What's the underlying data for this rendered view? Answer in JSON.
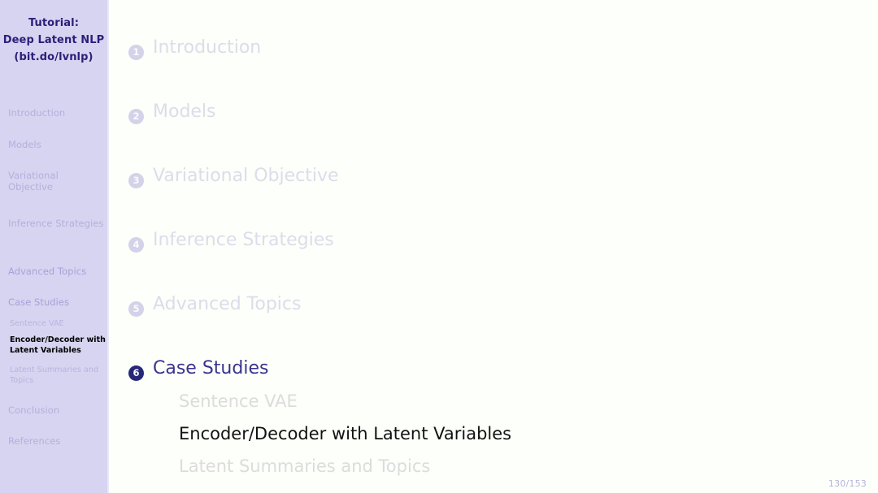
{
  "slide": {
    "kind": "beamer-outline-slide",
    "background_color": "#fdfffa",
    "page_number": "130/153"
  },
  "sidebar": {
    "background_color": "#d6d4f0",
    "title_lines": [
      "Tutorial:",
      "Deep Latent NLP",
      "(bit.do/lvnlp)"
    ],
    "title_color": "#2a1f7a",
    "sections": [
      {
        "label": "Introduction",
        "state": "inactive"
      },
      {
        "label": "Models",
        "state": "inactive"
      },
      {
        "label": "Variational Objective",
        "state": "inactive"
      },
      {
        "label": "Inference Strategies",
        "state": "inactive"
      },
      {
        "label": "Advanced Topics",
        "state": "visited"
      },
      {
        "label": "Case Studies",
        "state": "current"
      },
      {
        "label": "Conclusion",
        "state": "inactive"
      },
      {
        "label": "References",
        "state": "inactive"
      }
    ],
    "subsections": [
      {
        "label": "Sentence VAE",
        "state": "inactive"
      },
      {
        "label": "Encoder/Decoder with Latent Variables",
        "state": "active"
      },
      {
        "label": "Latent Summaries and Topics",
        "state": "inactive"
      }
    ]
  },
  "outline": {
    "sections": [
      {
        "number": "1",
        "label": "Introduction",
        "state": "inactive"
      },
      {
        "number": "2",
        "label": "Models",
        "state": "inactive"
      },
      {
        "number": "3",
        "label": "Variational Objective",
        "state": "inactive"
      },
      {
        "number": "4",
        "label": "Inference Strategies",
        "state": "inactive"
      },
      {
        "number": "5",
        "label": "Advanced Topics",
        "state": "inactive"
      },
      {
        "number": "6",
        "label": "Case Studies",
        "state": "current"
      }
    ],
    "subsections": [
      {
        "label": "Sentence VAE",
        "state": "inactive"
      },
      {
        "label": "Encoder/Decoder with Latent Variables",
        "state": "active"
      },
      {
        "label": "Latent Summaries and Topics",
        "state": "inactive"
      }
    ]
  },
  "colors": {
    "accent_navy": "#272779",
    "sidebar_bg": "#d6d4f0",
    "inactive_text": "#dddcea",
    "active_text": "#121212"
  }
}
